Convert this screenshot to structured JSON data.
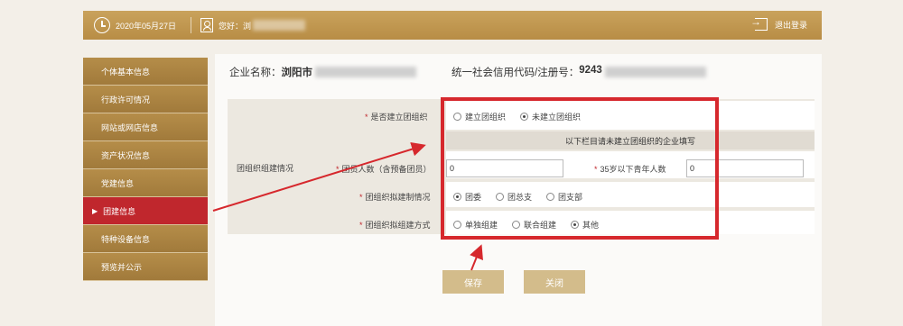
{
  "header": {
    "date": "2020年05月27日",
    "greeting": "您好：浏",
    "logout_label": "退出登录"
  },
  "sidebar": {
    "items": [
      {
        "label": "个体基本信息"
      },
      {
        "label": "行政许可情况"
      },
      {
        "label": "网站或网店信息"
      },
      {
        "label": "资产状况信息"
      },
      {
        "label": "党建信息"
      },
      {
        "label": "团建信息",
        "active": true
      },
      {
        "label": "特种设备信息"
      },
      {
        "label": "预览并公示"
      }
    ]
  },
  "company": {
    "name_label": "企业名称：",
    "name_value": "浏阳市",
    "credit_label": "统一社会信用代码/注册号：",
    "credit_value": "9243"
  },
  "form": {
    "section_label": "团组织组建情况",
    "q_established": {
      "label": "是否建立团组织",
      "options": [
        "建立团组织",
        "未建立团组织"
      ],
      "selected": 1
    },
    "notice": "以下栏目请未建立团组织的企业填写",
    "q_members": {
      "label": "团员人数（含预备团员）",
      "value": "0"
    },
    "q_youth": {
      "label": "35岁以下青年人数",
      "value": "0"
    },
    "q_structure": {
      "label": "团组织拟建制情况",
      "options": [
        "团委",
        "团总支",
        "团支部"
      ],
      "selected": 0
    },
    "q_method": {
      "label": "团组织拟组建方式",
      "options": [
        "单独组建",
        "联合组建",
        "其他"
      ],
      "selected": 2
    }
  },
  "buttons": {
    "save": "保存",
    "close": "关闭"
  },
  "annotation_color": "#d6282d"
}
